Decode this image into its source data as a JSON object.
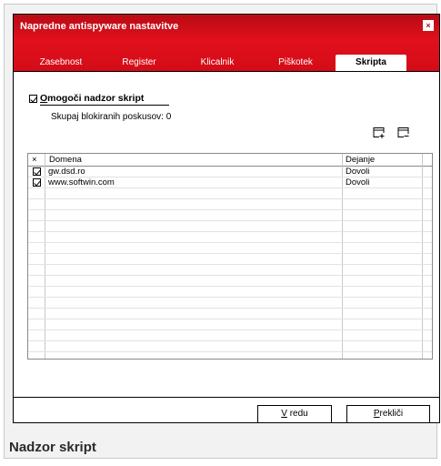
{
  "dialog": {
    "title": "Napredne antispyware nastavitve"
  },
  "tabs": [
    {
      "label": "Zasebnost",
      "active": false
    },
    {
      "label": "Register",
      "active": false
    },
    {
      "label": "Klicalnik",
      "active": false
    },
    {
      "label": "Piškotek",
      "active": false
    },
    {
      "label": "Skripta",
      "active": true
    }
  ],
  "script_control": {
    "enable_label_underlined": "O",
    "enable_label_rest": "mogoči nadzor skript",
    "enabled": true,
    "blocked_count_text": "Skupaj blokiranih poskusov: 0"
  },
  "toolbar": {
    "add_icon": "add-domain-icon",
    "remove_icon": "remove-domain-icon"
  },
  "table": {
    "headers": [
      "×",
      "Domena",
      "Dejanje"
    ],
    "rows": [
      {
        "checked": true,
        "domain": "gw.dsd.ro",
        "action": "Dovoli"
      },
      {
        "checked": true,
        "domain": "www.softwin.com",
        "action": "Dovoli"
      }
    ]
  },
  "buttons": {
    "ok_underlined": "V",
    "ok_rest": " redu",
    "cancel_underlined": "P",
    "cancel_rest": "rekliči"
  },
  "caption": "Nadzor skript",
  "colors": {
    "titlebar_red": "#d40c17"
  }
}
